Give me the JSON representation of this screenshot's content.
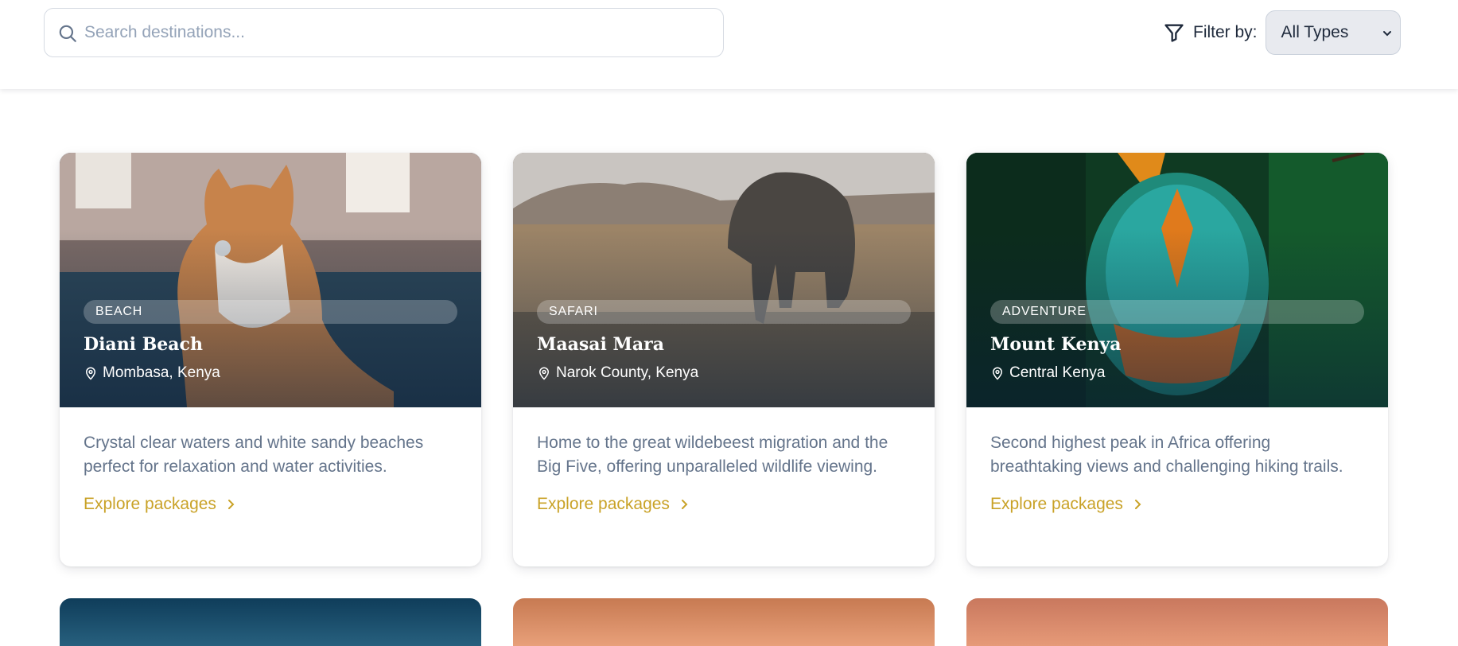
{
  "search": {
    "placeholder": "Search destinations..."
  },
  "filter": {
    "label": "Filter by:",
    "selected": "All Types"
  },
  "colors": {
    "accent": "#c9a227",
    "text_muted": "#64748b",
    "heading": "#1e293b"
  },
  "icons": {
    "search": "search-icon",
    "filter": "filter-funnel-icon",
    "dropdown": "chevron-down-icon",
    "location": "map-pin-icon",
    "arrow": "chevron-right-icon"
  },
  "cards": [
    {
      "category": "BEACH",
      "title": "Diani Beach",
      "location": "Mombasa, Kenya",
      "description": "Crystal clear waters and white sandy beaches perfect for relaxation and water activities.",
      "cta": "Explore packages"
    },
    {
      "category": "SAFARI",
      "title": "Maasai Mara",
      "location": "Narok County, Kenya",
      "description": "Home to the great wildebeest migration and the Big Five, offering unparalleled wildlife viewing.",
      "cta": "Explore packages"
    },
    {
      "category": "ADVENTURE",
      "title": "Mount Kenya",
      "location": "Central Kenya",
      "description": "Second highest peak in Africa offering breathtaking views and challenging hiking trails.",
      "cta": "Explore packages"
    }
  ]
}
